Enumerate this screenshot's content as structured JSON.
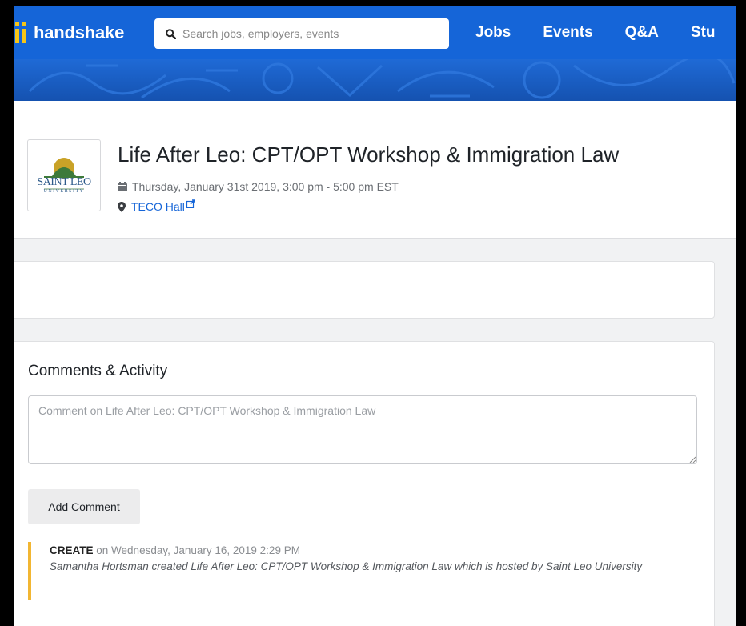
{
  "brand": {
    "name": "handshake",
    "accent": "#1565d8",
    "logo_color": "#f5c518"
  },
  "search": {
    "placeholder": "Search jobs, employers, events",
    "value": ""
  },
  "nav": {
    "items": [
      {
        "label": "Jobs"
      },
      {
        "label": "Events"
      },
      {
        "label": "Q&A"
      },
      {
        "label": "Stu"
      }
    ]
  },
  "event": {
    "title": "Life After Leo: CPT/OPT Workshop & Immigration Law",
    "date": "Thursday, January 31st 2019, 3:00 pm - 5:00 pm EST",
    "location": "TECO Hall",
    "org_logo": {
      "line1": "SAINT LEO",
      "line2": "UNIVERSITY",
      "icon": "saint-leo-seal",
      "colors": {
        "green": "#3d7a3a",
        "gold": "#c9a227"
      }
    },
    "icons": {
      "date": "calendar-icon",
      "location": "map-pin-icon",
      "external": "external-link-icon"
    }
  },
  "comments": {
    "heading": "Comments & Activity",
    "placeholder": "Comment on Life After Leo: CPT/OPT Workshop & Immigration Law",
    "value": "",
    "add_button": "Add Comment",
    "activity": [
      {
        "type": "CREATE",
        "when": "on Wednesday, January 16, 2019 2:29 PM",
        "description": "Samantha Hortsman created Life After Leo: CPT/OPT Workshop & Immigration Law which is hosted by Saint Leo University",
        "accent": "#f2b632"
      }
    ]
  }
}
